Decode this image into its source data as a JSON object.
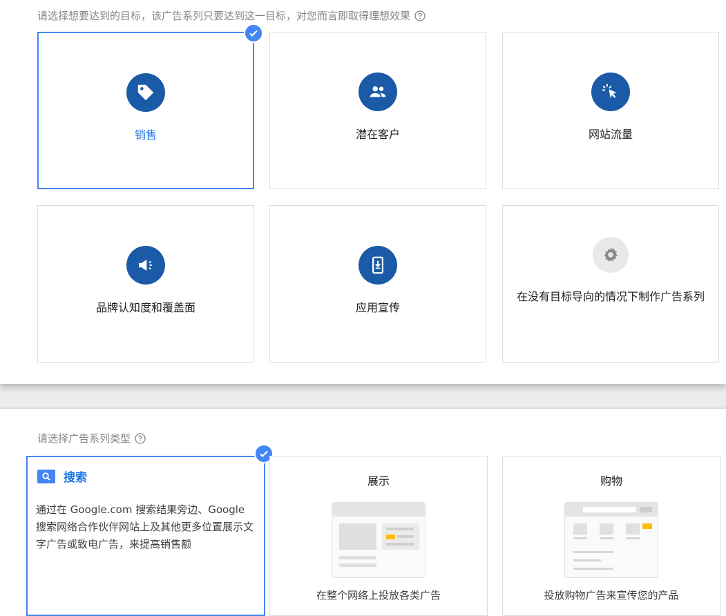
{
  "goals_section": {
    "prompt": "请选择想要达到的目标，该广告系列只要达到这一目标，对您而言即取得理想效果",
    "goals": [
      {
        "label": "销售",
        "icon": "tag-icon",
        "selected": true
      },
      {
        "label": "潜在客户",
        "icon": "people-icon",
        "selected": false
      },
      {
        "label": "网站流量",
        "icon": "cursor-click-icon",
        "selected": false
      },
      {
        "label": "品牌认知度和覆盖面",
        "icon": "megaphone-icon",
        "selected": false
      },
      {
        "label": "应用宣传",
        "icon": "phone-download-icon",
        "selected": false
      },
      {
        "label": "在没有目标导向的情况下制作广告系列",
        "icon": "gear-icon",
        "selected": false
      }
    ]
  },
  "types_section": {
    "prompt": "请选择广告系列类型",
    "types": [
      {
        "title": "搜索",
        "icon": "search-icon",
        "selected": true,
        "description": "通过在 Google.com 搜索结果旁边、Google 搜索网络合作伙伴网站上及其他更多位置展示文字广告或致电广告，来提高销售额"
      },
      {
        "title": "展示",
        "caption": "在整个网络上投放各类广告",
        "selected": false
      },
      {
        "title": "购物",
        "caption": "投放购物广告来宣传您的产品",
        "selected": false
      }
    ]
  },
  "colors": {
    "accent": "#4285f4",
    "icon_circle": "#1a5aa6",
    "selected_text": "#1a73e8",
    "highlight": "#fbbc04"
  }
}
